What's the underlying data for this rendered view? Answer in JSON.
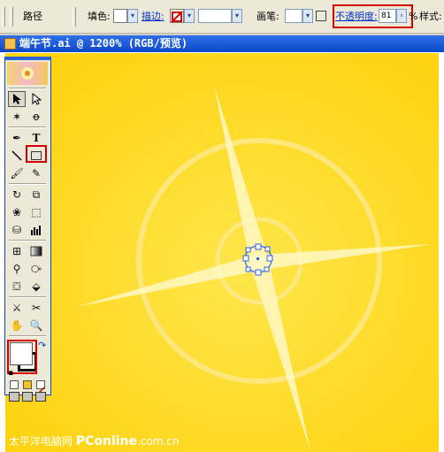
{
  "control_bar": {
    "path_label": "路径",
    "fill_label": "填色:",
    "stroke_label": "描边:",
    "brush_label": "画笔:",
    "opacity_label": "不透明度:",
    "opacity_value": "81",
    "percent": "%",
    "style_label": "样式:"
  },
  "document": {
    "title": "端午节.ai @ 1200% (RGB/预览)"
  },
  "toolbox": {
    "type_glyph": "T"
  },
  "watermark": {
    "brand": "太平洋电脑网",
    "site_big": "PConline",
    "site_tail": ".com.cn"
  },
  "colors": {
    "canvas": "#fed51d",
    "highlight": "#d40000",
    "titlebar": "#0b48c9"
  }
}
